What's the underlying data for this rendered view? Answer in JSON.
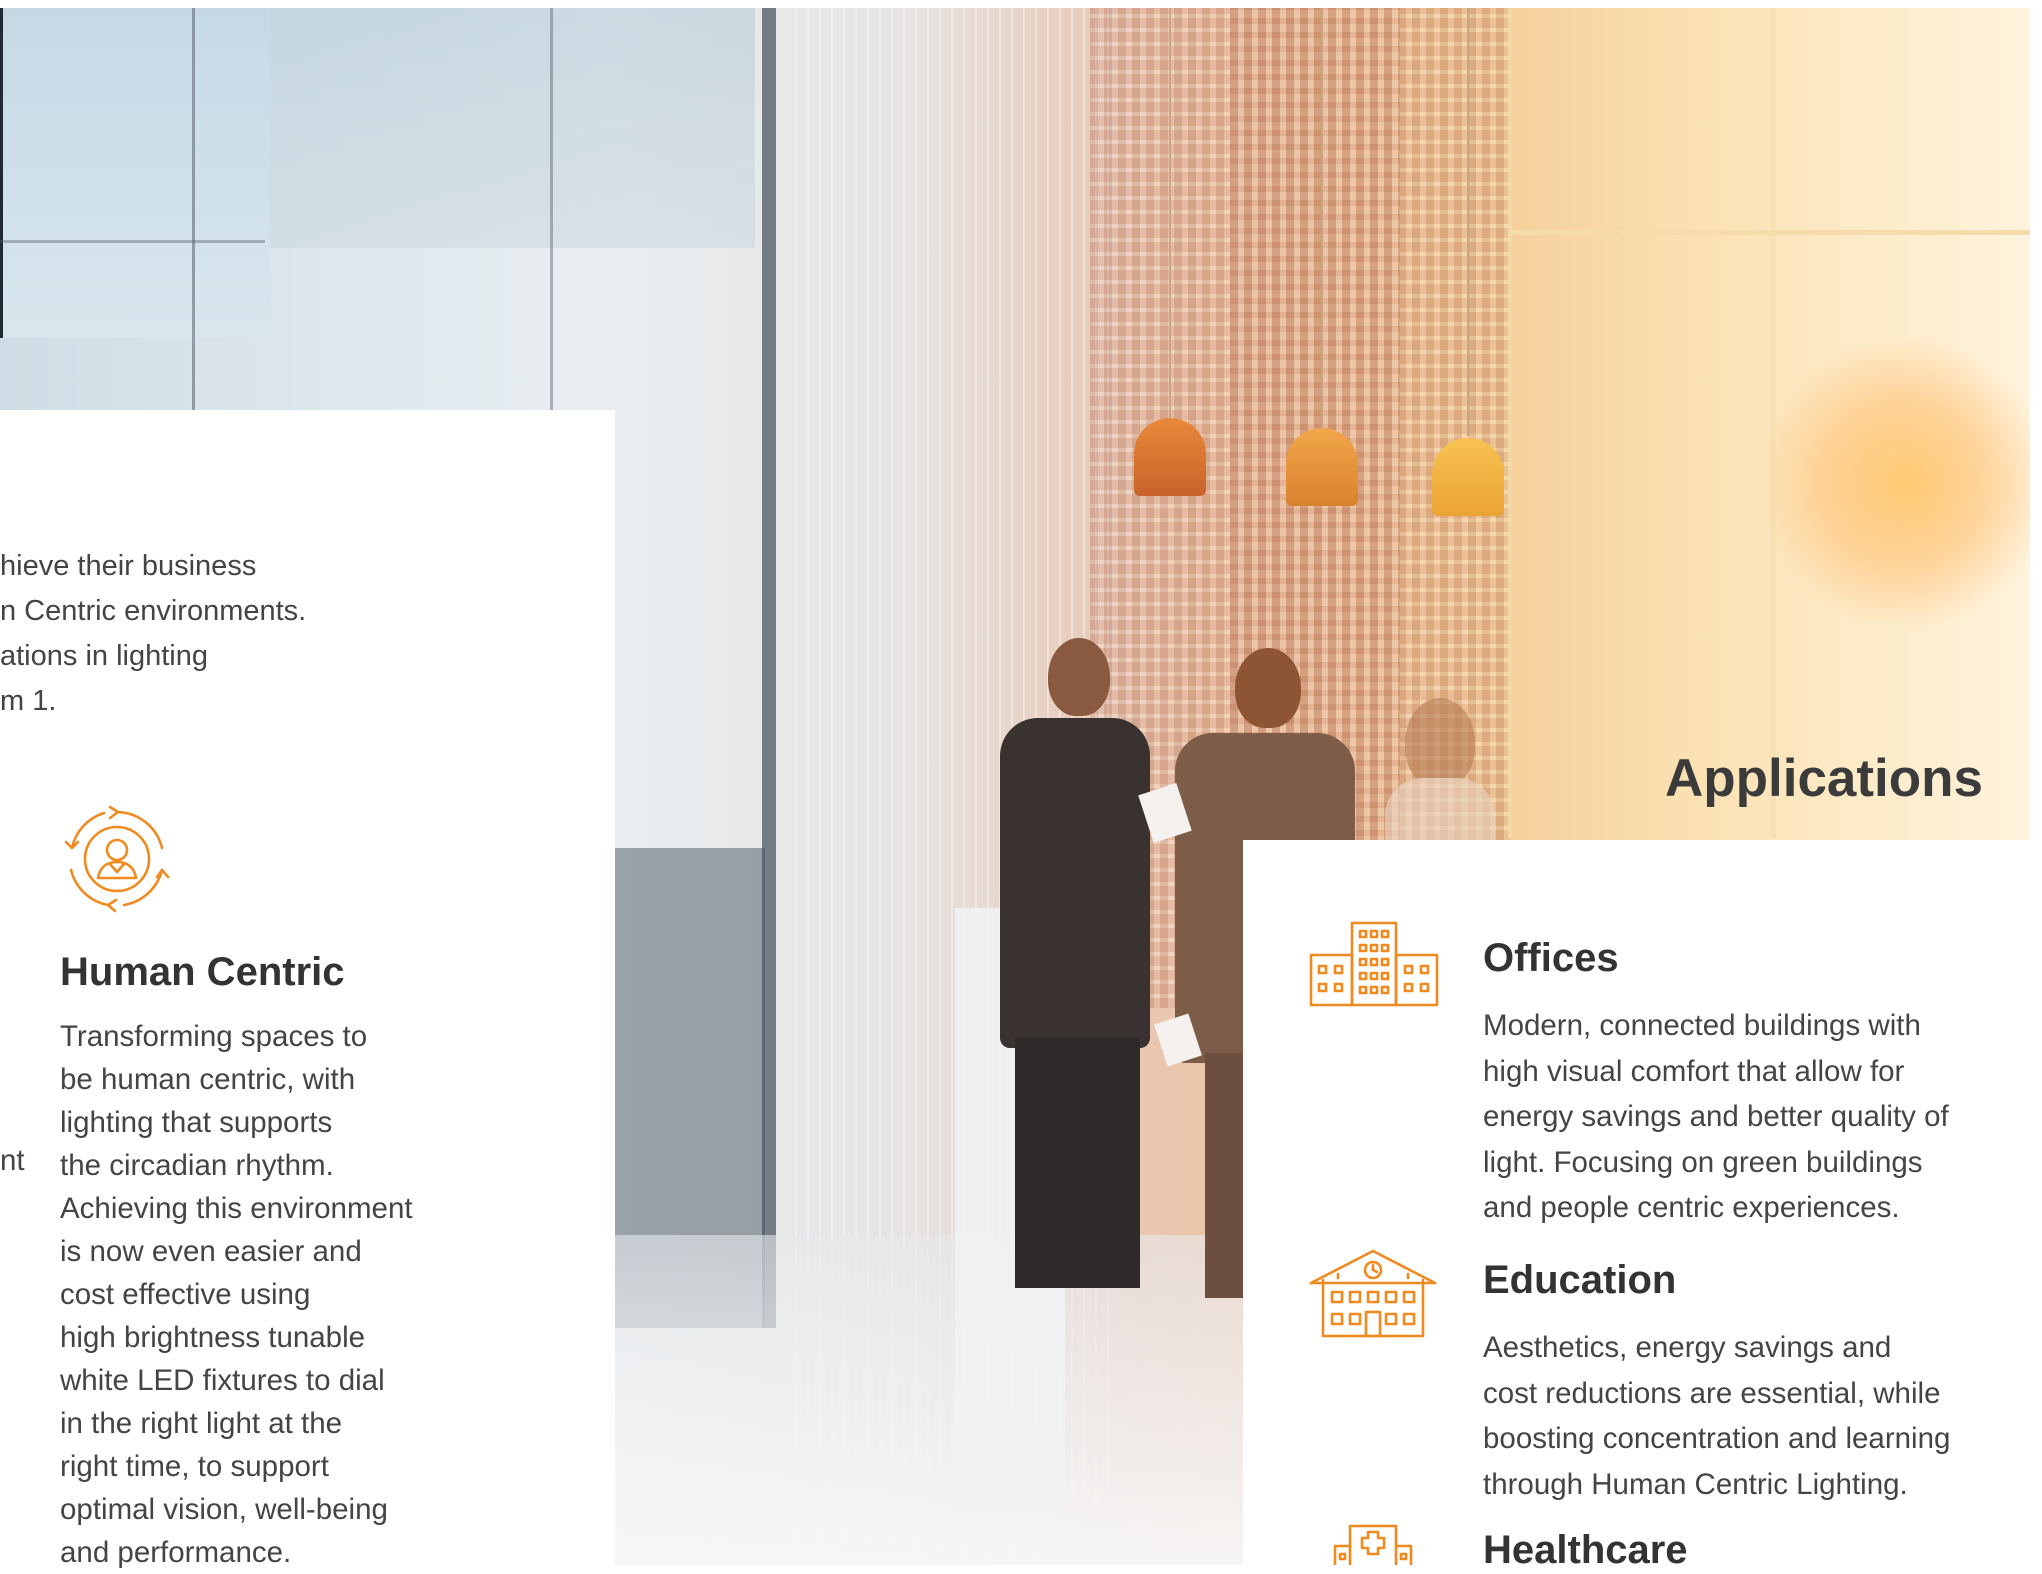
{
  "intro_lines": [
    "hieve their business",
    "n Centric environments.",
    "ations in lighting",
    "m 1."
  ],
  "human_centric": {
    "title": "Human Centric",
    "body_lines": [
      "Transforming spaces to",
      "be human centric, with",
      "lighting  that supports",
      "the circadian rhythm.",
      "Achieving this environment",
      "is now even easier and",
      "cost effective using",
      "high brightness tunable",
      "white LED fixtures to dial",
      "in the right light at the",
      "right time, to support",
      "optimal vision, well-being",
      "and performance."
    ],
    "left_fragment": "nt",
    "icon": "person-cycle-icon"
  },
  "applications": {
    "heading": "Applications",
    "items": [
      {
        "title": "Offices",
        "icon": "office-building-icon",
        "body_lines": [
          "Modern, connected buildings with",
          "high visual comfort that allow for",
          "energy savings and better quality of",
          "light. Focusing on green buildings",
          "and people centric experiences."
        ]
      },
      {
        "title": "Education",
        "icon": "school-building-icon",
        "body_lines": [
          "Aesthetics, energy savings and",
          "cost reductions are essential, while",
          "boosting concentration and learning",
          "through Human Centric Lighting."
        ]
      },
      {
        "title": "Healthcare",
        "icon": "hospital-icon",
        "body_lines": []
      }
    ]
  },
  "colors": {
    "accent": "#f08a1e",
    "text": "#444444",
    "heading": "#333333"
  }
}
